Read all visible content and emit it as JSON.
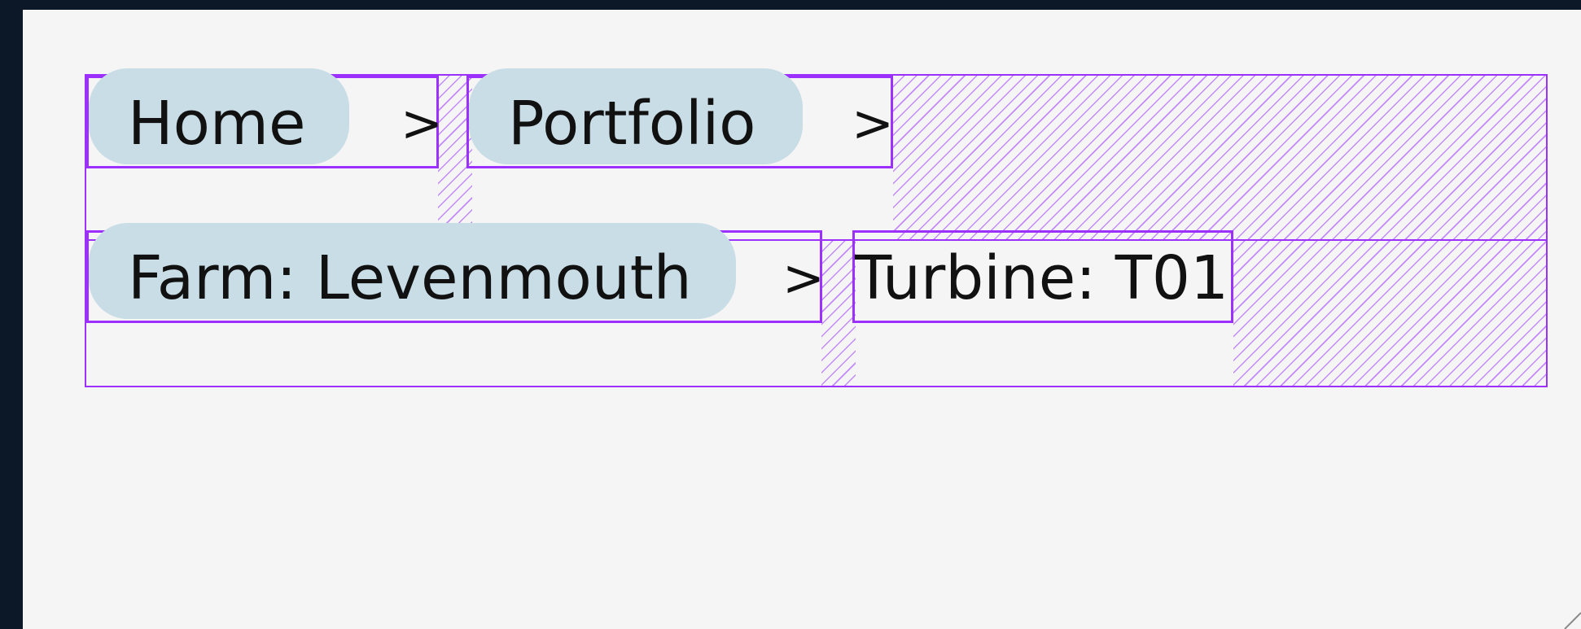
{
  "breadcrumb": {
    "items": [
      {
        "label": "Home",
        "separator": ">"
      },
      {
        "label": "Portfolio",
        "separator": ">"
      },
      {
        "label": "Farm: Levenmouth",
        "separator": ">"
      },
      {
        "label": "Turbine: T01"
      }
    ]
  },
  "colors": {
    "page_background": "#0c1727",
    "viewport_background": "#f5f5f5",
    "crumb_pill": "#c9dde6",
    "overlay_outline": "#9b30ff"
  }
}
